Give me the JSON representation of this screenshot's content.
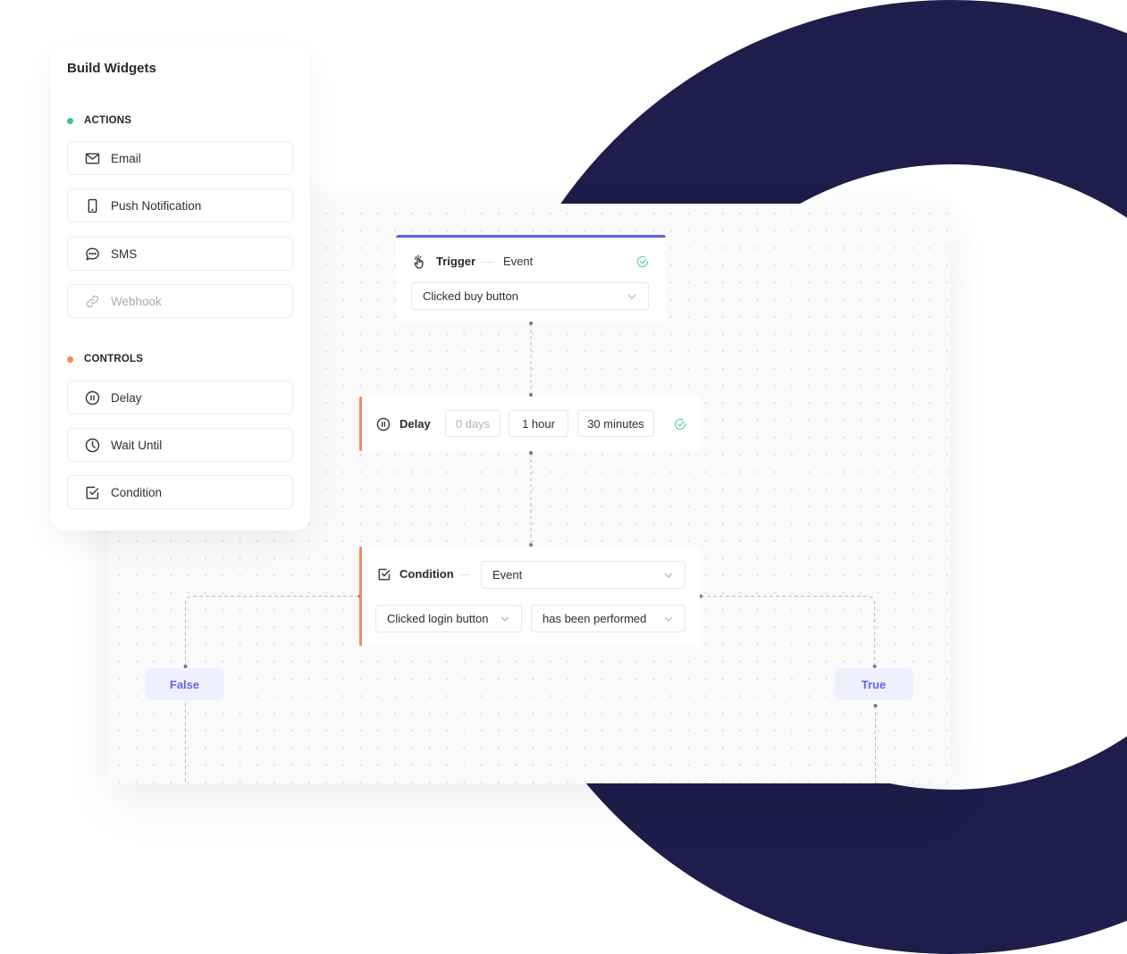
{
  "theme": {
    "indigo": "#5f5fe8",
    "orange": "#f28a5c",
    "green": "#5fcfa0",
    "navy": "#1f1d4b",
    "dot-actions": "#45c08f",
    "dot-controls": "#f28a5c",
    "pill-bg": "#eff0fd",
    "pill-text": "#6466ee"
  },
  "sidebar": {
    "title": "Build Widgets",
    "sections": [
      {
        "label": "ACTIONS",
        "items": [
          {
            "label": "Email",
            "icon": "envelope-icon"
          },
          {
            "label": "Push Notification",
            "icon": "mobile-phone-icon"
          },
          {
            "label": "SMS",
            "icon": "chat-bubble-icon"
          },
          {
            "label": "Webhook",
            "icon": "link-icon",
            "disabled": true
          }
        ]
      },
      {
        "label": "CONTROLS",
        "items": [
          {
            "label": "Delay",
            "icon": "pause-circle-icon"
          },
          {
            "label": "Wait Until",
            "icon": "clock-icon"
          },
          {
            "label": "Condition",
            "icon": "checkbox-icon"
          }
        ]
      }
    ]
  },
  "flow": {
    "trigger": {
      "title": "Trigger",
      "type": "Event",
      "event": "Clicked buy button",
      "status": "valid"
    },
    "delay": {
      "title": "Delay",
      "days_placeholder": "0 days",
      "hours": "1 hour",
      "minutes": "30 minutes",
      "status": "valid"
    },
    "condition": {
      "title": "Condition",
      "type": "Event",
      "event": "Clicked login button",
      "operator": "has been performed"
    },
    "branches": {
      "false_label": "False",
      "true_label": "True"
    }
  }
}
